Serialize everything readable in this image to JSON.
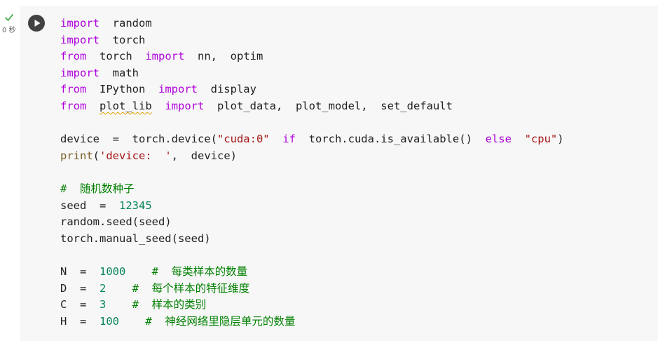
{
  "status": {
    "check_icon": "checkmark-icon",
    "check_color": "#4caf50",
    "exec_time": "0 秒"
  },
  "run_button": {
    "icon": "play-icon"
  },
  "colors": {
    "keyword": "#af00db",
    "builtin_keyword": "#0000ff",
    "string": "#a31515",
    "number": "#098658",
    "comment": "#008000",
    "function": "#795e26",
    "cell_background": "#f7f7f7"
  },
  "code_lines": [
    [
      {
        "t": "import",
        "c": "kw"
      },
      {
        "t": "  random"
      }
    ],
    [
      {
        "t": "import",
        "c": "kw"
      },
      {
        "t": "  torch"
      }
    ],
    [
      {
        "t": "from",
        "c": "kw"
      },
      {
        "t": "  torch  "
      },
      {
        "t": "import",
        "c": "kw"
      },
      {
        "t": "  nn,  optim"
      }
    ],
    [
      {
        "t": "import",
        "c": "kw"
      },
      {
        "t": "  math"
      }
    ],
    [
      {
        "t": "from",
        "c": "kw"
      },
      {
        "t": "  IPython  "
      },
      {
        "t": "import",
        "c": "kw"
      },
      {
        "t": "  display"
      }
    ],
    [
      {
        "t": "from",
        "c": "kw"
      },
      {
        "t": "  "
      },
      {
        "t": "plot_lib",
        "c": "squiggle"
      },
      {
        "t": "  "
      },
      {
        "t": "import",
        "c": "kw"
      },
      {
        "t": "  plot_data,  plot_model,  set_default"
      }
    ],
    [],
    [
      {
        "t": "device  =  torch.device("
      },
      {
        "t": "\"cuda:0\"",
        "c": "str"
      },
      {
        "t": "  "
      },
      {
        "t": "if",
        "c": "kw"
      },
      {
        "t": "  torch.cuda.is_available()  "
      },
      {
        "t": "else",
        "c": "kw"
      },
      {
        "t": "  "
      },
      {
        "t": "\"cpu\"",
        "c": "str"
      },
      {
        "t": ")"
      }
    ],
    [
      {
        "t": "print",
        "c": "fn"
      },
      {
        "t": "("
      },
      {
        "t": "'device:  '",
        "c": "str"
      },
      {
        "t": ",  device)"
      }
    ],
    [],
    [
      {
        "t": "#  随机数种子",
        "c": "cmt"
      }
    ],
    [
      {
        "t": "seed  =  "
      },
      {
        "t": "12345",
        "c": "num"
      }
    ],
    [
      {
        "t": "random.seed(seed)"
      }
    ],
    [
      {
        "t": "torch.manual_seed(seed)"
      }
    ],
    [],
    [
      {
        "t": "N  =  "
      },
      {
        "t": "1000",
        "c": "num"
      },
      {
        "t": "    "
      },
      {
        "t": "#  每类样本的数量",
        "c": "cmt"
      }
    ],
    [
      {
        "t": "D  =  "
      },
      {
        "t": "2",
        "c": "num"
      },
      {
        "t": "    "
      },
      {
        "t": "#  每个样本的特征维度",
        "c": "cmt"
      }
    ],
    [
      {
        "t": "C  =  "
      },
      {
        "t": "3",
        "c": "num"
      },
      {
        "t": "    "
      },
      {
        "t": "#  样本的类别",
        "c": "cmt"
      }
    ],
    [
      {
        "t": "H  =  "
      },
      {
        "t": "100",
        "c": "num"
      },
      {
        "t": "    "
      },
      {
        "t": "#  神经网络里隐层单元的数量",
        "c": "cmt"
      }
    ]
  ]
}
